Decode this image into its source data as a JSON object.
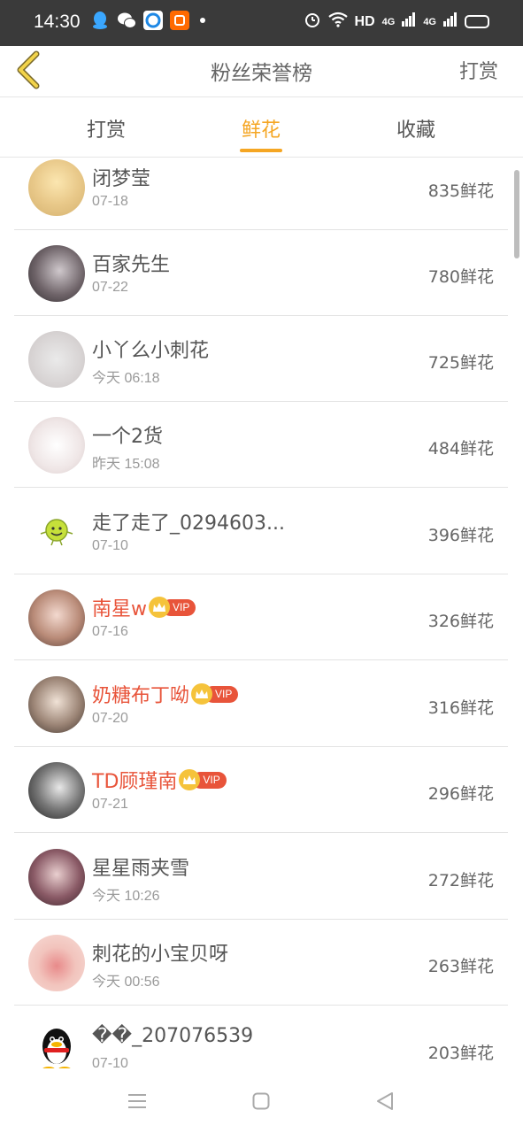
{
  "status": {
    "time": "14:30",
    "network": "HD",
    "signal1": "4G",
    "signal2": "4G"
  },
  "header": {
    "title": "粉丝荣誉榜",
    "action": "打赏"
  },
  "tabs": [
    {
      "label": "打赏",
      "active": false
    },
    {
      "label": "鲜花",
      "active": true
    },
    {
      "label": "收藏",
      "active": false
    }
  ],
  "vip_label": "VIP",
  "entries": [
    {
      "name": "闭梦莹",
      "date": "07-18",
      "count": "835鲜花",
      "vip": false
    },
    {
      "name": "百家先生",
      "date": "07-22",
      "count": "780鲜花",
      "vip": false
    },
    {
      "name": "小丫么小刺花",
      "date": "今天 06:18",
      "count": "725鲜花",
      "vip": false
    },
    {
      "name": "一个2货",
      "date": "昨天 15:08",
      "count": "484鲜花",
      "vip": false
    },
    {
      "name": "走了走了_0294603...",
      "date": "07-10",
      "count": "396鲜花",
      "vip": false
    },
    {
      "name": "南星w",
      "date": "07-16",
      "count": "326鲜花",
      "vip": true
    },
    {
      "name": "奶糖布丁呦",
      "date": "07-20",
      "count": "316鲜花",
      "vip": true
    },
    {
      "name": "TD顾瑾南",
      "date": "07-21",
      "count": "296鲜花",
      "vip": true
    },
    {
      "name": "星星雨夹雪",
      "date": "今天 10:26",
      "count": "272鲜花",
      "vip": false
    },
    {
      "name": "刺花的小宝贝呀",
      "date": "今天 00:56",
      "count": "263鲜花",
      "vip": false
    },
    {
      "name": "��_207076539",
      "date": "07-10",
      "count": "203鲜花",
      "vip": false
    }
  ],
  "colors": {
    "accent": "#f5a623",
    "vip": "#e8543a",
    "status_bar": "#3a3a3a"
  },
  "icons": {
    "back": "chevron-left-icon",
    "nav": [
      "menu-icon",
      "home-square-icon",
      "back-triangle-icon"
    ]
  }
}
